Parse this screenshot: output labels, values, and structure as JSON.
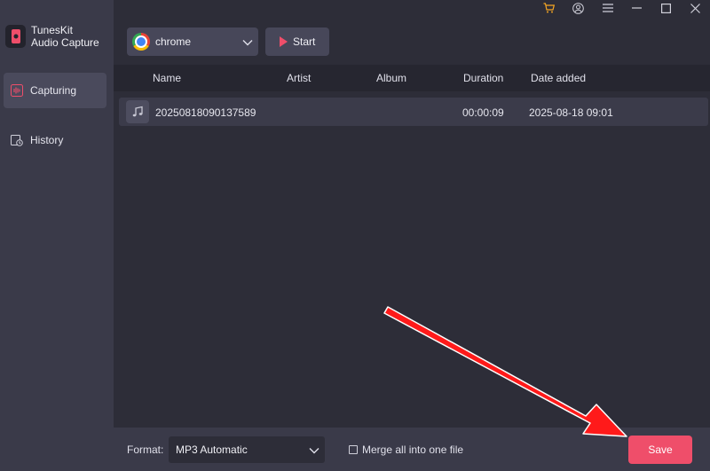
{
  "app": {
    "name_line1": "TunesKit",
    "name_line2": "Audio Capture"
  },
  "sidebar": {
    "items": [
      {
        "label": "Capturing",
        "icon": "audio-wave-icon",
        "active": true
      },
      {
        "label": "History",
        "icon": "history-icon",
        "active": false
      }
    ]
  },
  "window_controls": [
    "cart-icon",
    "account-icon",
    "menu-icon",
    "minimize-icon",
    "maximize-icon",
    "close-icon"
  ],
  "toolbar": {
    "source_label": "chrome",
    "start_label": "Start"
  },
  "table": {
    "headers": {
      "name": "Name",
      "artist": "Artist",
      "album": "Album",
      "duration": "Duration",
      "date": "Date added"
    },
    "rows": [
      {
        "name": "20250818090137589",
        "artist": "",
        "album": "",
        "duration": "00:00:09",
        "date": "2025-08-18 09:01"
      }
    ]
  },
  "bottom": {
    "format_label": "Format:",
    "format_value": "MP3 Automatic",
    "merge_label": "Merge all into one file",
    "merge_checked": false,
    "save_label": "Save"
  },
  "colors": {
    "accent": "#ef4e6a",
    "cart": "#f5a623",
    "annotation_arrow": "#ff1a1a"
  }
}
